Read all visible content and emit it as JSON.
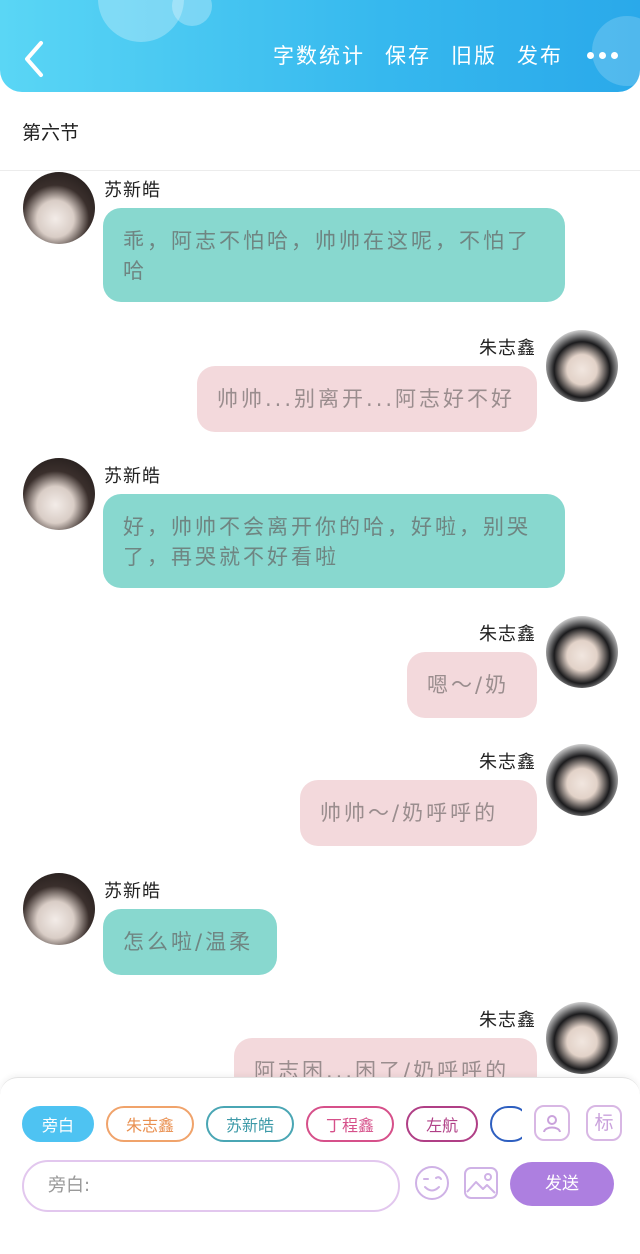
{
  "header": {
    "actions": [
      "字数统计",
      "保存",
      "旧版",
      "发布"
    ],
    "colors": {
      "start": "#5ad6f5",
      "end": "#2aa9ea"
    }
  },
  "section": {
    "title": "第六节"
  },
  "messages": [
    {
      "side": "left",
      "name": "苏新皓",
      "text": "乖，阿志不怕哈，帅帅在这呢，不怕了哈"
    },
    {
      "side": "right",
      "name": "朱志鑫",
      "text": "帅帅...别离开...阿志好不好"
    },
    {
      "side": "left",
      "name": "苏新皓",
      "text": "好，帅帅不会离开你的哈，好啦，别哭了，再哭就不好看啦"
    },
    {
      "side": "right",
      "name": "朱志鑫",
      "text": "嗯～/奶"
    },
    {
      "side": "right",
      "name": "朱志鑫",
      "text": "帅帅～/奶呼呼的"
    },
    {
      "side": "left",
      "name": "苏新皓",
      "text": "怎么啦/温柔"
    },
    {
      "side": "right",
      "name": "朱志鑫",
      "text": "阿志困...困了/奶呼呼的"
    }
  ],
  "panel": {
    "roles": [
      {
        "label": "旁白",
        "color": "#4ec3f2",
        "active": true
      },
      {
        "label": "朱志鑫",
        "color": "#f0a36b",
        "active": false
      },
      {
        "label": "苏新皓",
        "color": "#4aa6b4",
        "active": false
      },
      {
        "label": "丁程鑫",
        "color": "#d6508a",
        "active": false
      },
      {
        "label": "左航",
        "color": "#b03f86",
        "active": false
      },
      {
        "label": "",
        "color": "#2e5fc0",
        "active": false
      }
    ],
    "tools": {
      "mark_label": "标"
    },
    "input_placeholder": "旁白:",
    "send_label": "发送",
    "accent": "#ad7fe0"
  }
}
